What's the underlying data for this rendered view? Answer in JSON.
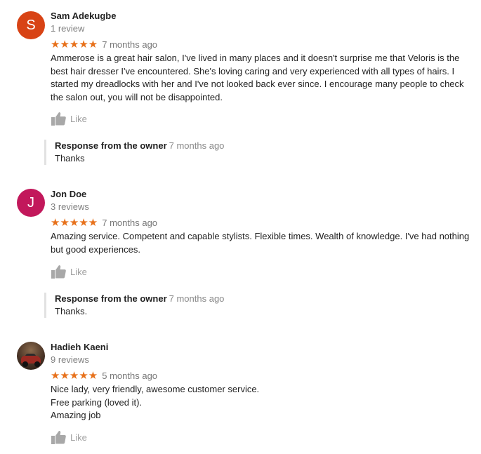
{
  "reviews": [
    {
      "avatar_letter": "S",
      "avatar_color": "#d84315",
      "name": "Sam Adekugbe",
      "review_count": "1 review",
      "stars": "★★★★★",
      "rating": 5,
      "date": "7 months ago",
      "text": "Ammerose is a great hair salon, I've lived in many places and it doesn't surprise me that Veloris is the best hair dresser I've encountered. She's loving caring and very experienced with all types of hairs. I started my dreadlocks with her and I've not looked back ever since. I encourage many people to check the salon out, you will not be disappointed.",
      "like_label": "Like",
      "owner_response": {
        "header": "Response from the owner",
        "date": "7 months ago",
        "text": "Thanks"
      }
    },
    {
      "avatar_letter": "J",
      "avatar_color": "#c2185b",
      "name": "Jon Doe",
      "review_count": "3 reviews",
      "stars": "★★★★★",
      "rating": 5,
      "date": "7 months ago",
      "text": "Amazing service. Competent and capable stylists. Flexible times. Wealth of knowledge. I've had nothing but good experiences.",
      "like_label": "Like",
      "owner_response": {
        "header": "Response from the owner",
        "date": "7 months ago",
        "text": "Thanks."
      }
    },
    {
      "avatar_letter": "",
      "name": "Hadieh Kaeni",
      "review_count": "9 reviews",
      "stars": "★★★★★",
      "rating": 5,
      "date": "5 months ago",
      "text": "Nice lady, very friendly, awesome customer service.\nFree parking (loved it).\nAmazing job",
      "like_label": "Like"
    }
  ],
  "colors": {
    "star": "#e7711b",
    "muted": "#808080",
    "like": "#a0a0a0"
  }
}
